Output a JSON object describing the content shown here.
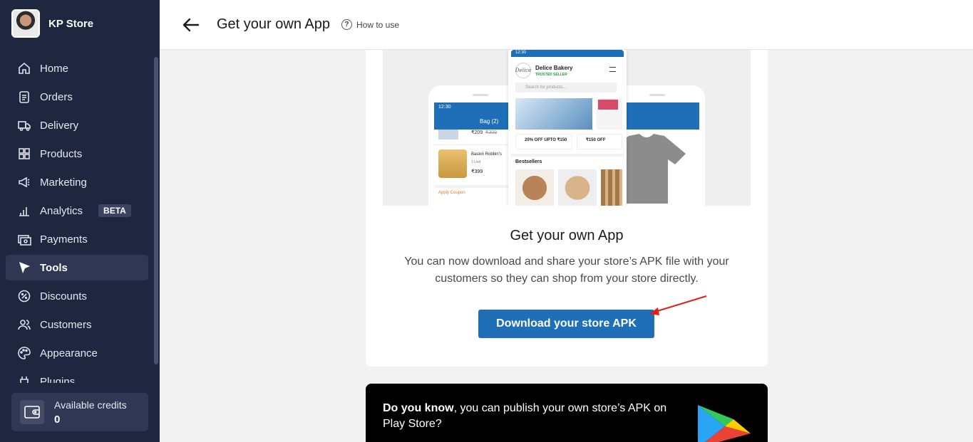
{
  "sidebar": {
    "store_name": "KP Store",
    "items": [
      {
        "label": "Home",
        "icon": "home-icon"
      },
      {
        "label": "Orders",
        "icon": "clipboard-icon"
      },
      {
        "label": "Delivery",
        "icon": "truck-icon"
      },
      {
        "label": "Products",
        "icon": "grid-icon"
      },
      {
        "label": "Marketing",
        "icon": "megaphone-icon"
      },
      {
        "label": "Analytics",
        "icon": "bar-chart-icon",
        "badge": "BETA"
      },
      {
        "label": "Payments",
        "icon": "cash-icon"
      },
      {
        "label": "Tools",
        "icon": "cursor-icon",
        "active": true
      },
      {
        "label": "Discounts",
        "icon": "percent-badge-icon"
      },
      {
        "label": "Customers",
        "icon": "users-icon"
      },
      {
        "label": "Appearance",
        "icon": "palette-icon"
      },
      {
        "label": "Plugins",
        "icon": "plug-icon"
      }
    ],
    "credits": {
      "label": "Available credits",
      "value": "0"
    }
  },
  "header": {
    "title": "Get your own App",
    "how_to": "How to use"
  },
  "main": {
    "title": "Get your own App",
    "description": "You can now download and share your store’s APK file with your customers so they can shop from your store directly.",
    "download_label": "Download your store APK"
  },
  "mockup": {
    "time": "12:30",
    "store": "Delice Bakery",
    "trusted": "TRUSTED SELLER",
    "search_placeholder": "Search for products...",
    "offer1": "20% OFF UPTO ₹150",
    "offer2": "₹150 OFF",
    "bestsellers": "Bestsellers",
    "bag": "Bag (2)",
    "price1": "₹209",
    "price1_old": "₹309",
    "item": "Baskin Robbin's",
    "unit": "1 Unit",
    "price2": "₹399",
    "coupon": "Apply Coupon"
  },
  "info": {
    "bold": "Do you know",
    "text": ", you can publish your own store’s APK on Play Store?"
  },
  "colors": {
    "sidebar_bg": "#1e2640",
    "accent": "#1e6fb8",
    "arrow": "#e02020"
  }
}
